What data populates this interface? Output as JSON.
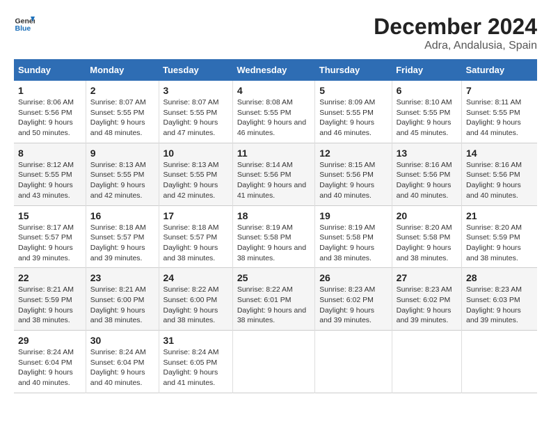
{
  "logo": {
    "general": "General",
    "blue": "Blue"
  },
  "title": "December 2024",
  "subtitle": "Adra, Andalusia, Spain",
  "headers": [
    "Sunday",
    "Monday",
    "Tuesday",
    "Wednesday",
    "Thursday",
    "Friday",
    "Saturday"
  ],
  "weeks": [
    [
      {
        "day": "1",
        "sunrise": "Sunrise: 8:06 AM",
        "sunset": "Sunset: 5:56 PM",
        "daylight": "Daylight: 9 hours and 50 minutes."
      },
      {
        "day": "2",
        "sunrise": "Sunrise: 8:07 AM",
        "sunset": "Sunset: 5:55 PM",
        "daylight": "Daylight: 9 hours and 48 minutes."
      },
      {
        "day": "3",
        "sunrise": "Sunrise: 8:07 AM",
        "sunset": "Sunset: 5:55 PM",
        "daylight": "Daylight: 9 hours and 47 minutes."
      },
      {
        "day": "4",
        "sunrise": "Sunrise: 8:08 AM",
        "sunset": "Sunset: 5:55 PM",
        "daylight": "Daylight: 9 hours and 46 minutes."
      },
      {
        "day": "5",
        "sunrise": "Sunrise: 8:09 AM",
        "sunset": "Sunset: 5:55 PM",
        "daylight": "Daylight: 9 hours and 46 minutes."
      },
      {
        "day": "6",
        "sunrise": "Sunrise: 8:10 AM",
        "sunset": "Sunset: 5:55 PM",
        "daylight": "Daylight: 9 hours and 45 minutes."
      },
      {
        "day": "7",
        "sunrise": "Sunrise: 8:11 AM",
        "sunset": "Sunset: 5:55 PM",
        "daylight": "Daylight: 9 hours and 44 minutes."
      }
    ],
    [
      {
        "day": "8",
        "sunrise": "Sunrise: 8:12 AM",
        "sunset": "Sunset: 5:55 PM",
        "daylight": "Daylight: 9 hours and 43 minutes."
      },
      {
        "day": "9",
        "sunrise": "Sunrise: 8:13 AM",
        "sunset": "Sunset: 5:55 PM",
        "daylight": "Daylight: 9 hours and 42 minutes."
      },
      {
        "day": "10",
        "sunrise": "Sunrise: 8:13 AM",
        "sunset": "Sunset: 5:55 PM",
        "daylight": "Daylight: 9 hours and 42 minutes."
      },
      {
        "day": "11",
        "sunrise": "Sunrise: 8:14 AM",
        "sunset": "Sunset: 5:56 PM",
        "daylight": "Daylight: 9 hours and 41 minutes."
      },
      {
        "day": "12",
        "sunrise": "Sunrise: 8:15 AM",
        "sunset": "Sunset: 5:56 PM",
        "daylight": "Daylight: 9 hours and 40 minutes."
      },
      {
        "day": "13",
        "sunrise": "Sunrise: 8:16 AM",
        "sunset": "Sunset: 5:56 PM",
        "daylight": "Daylight: 9 hours and 40 minutes."
      },
      {
        "day": "14",
        "sunrise": "Sunrise: 8:16 AM",
        "sunset": "Sunset: 5:56 PM",
        "daylight": "Daylight: 9 hours and 40 minutes."
      }
    ],
    [
      {
        "day": "15",
        "sunrise": "Sunrise: 8:17 AM",
        "sunset": "Sunset: 5:57 PM",
        "daylight": "Daylight: 9 hours and 39 minutes."
      },
      {
        "day": "16",
        "sunrise": "Sunrise: 8:18 AM",
        "sunset": "Sunset: 5:57 PM",
        "daylight": "Daylight: 9 hours and 39 minutes."
      },
      {
        "day": "17",
        "sunrise": "Sunrise: 8:18 AM",
        "sunset": "Sunset: 5:57 PM",
        "daylight": "Daylight: 9 hours and 38 minutes."
      },
      {
        "day": "18",
        "sunrise": "Sunrise: 8:19 AM",
        "sunset": "Sunset: 5:58 PM",
        "daylight": "Daylight: 9 hours and 38 minutes."
      },
      {
        "day": "19",
        "sunrise": "Sunrise: 8:19 AM",
        "sunset": "Sunset: 5:58 PM",
        "daylight": "Daylight: 9 hours and 38 minutes."
      },
      {
        "day": "20",
        "sunrise": "Sunrise: 8:20 AM",
        "sunset": "Sunset: 5:58 PM",
        "daylight": "Daylight: 9 hours and 38 minutes."
      },
      {
        "day": "21",
        "sunrise": "Sunrise: 8:20 AM",
        "sunset": "Sunset: 5:59 PM",
        "daylight": "Daylight: 9 hours and 38 minutes."
      }
    ],
    [
      {
        "day": "22",
        "sunrise": "Sunrise: 8:21 AM",
        "sunset": "Sunset: 5:59 PM",
        "daylight": "Daylight: 9 hours and 38 minutes."
      },
      {
        "day": "23",
        "sunrise": "Sunrise: 8:21 AM",
        "sunset": "Sunset: 6:00 PM",
        "daylight": "Daylight: 9 hours and 38 minutes."
      },
      {
        "day": "24",
        "sunrise": "Sunrise: 8:22 AM",
        "sunset": "Sunset: 6:00 PM",
        "daylight": "Daylight: 9 hours and 38 minutes."
      },
      {
        "day": "25",
        "sunrise": "Sunrise: 8:22 AM",
        "sunset": "Sunset: 6:01 PM",
        "daylight": "Daylight: 9 hours and 38 minutes."
      },
      {
        "day": "26",
        "sunrise": "Sunrise: 8:23 AM",
        "sunset": "Sunset: 6:02 PM",
        "daylight": "Daylight: 9 hours and 39 minutes."
      },
      {
        "day": "27",
        "sunrise": "Sunrise: 8:23 AM",
        "sunset": "Sunset: 6:02 PM",
        "daylight": "Daylight: 9 hours and 39 minutes."
      },
      {
        "day": "28",
        "sunrise": "Sunrise: 8:23 AM",
        "sunset": "Sunset: 6:03 PM",
        "daylight": "Daylight: 9 hours and 39 minutes."
      }
    ],
    [
      {
        "day": "29",
        "sunrise": "Sunrise: 8:24 AM",
        "sunset": "Sunset: 6:04 PM",
        "daylight": "Daylight: 9 hours and 40 minutes."
      },
      {
        "day": "30",
        "sunrise": "Sunrise: 8:24 AM",
        "sunset": "Sunset: 6:04 PM",
        "daylight": "Daylight: 9 hours and 40 minutes."
      },
      {
        "day": "31",
        "sunrise": "Sunrise: 8:24 AM",
        "sunset": "Sunset: 6:05 PM",
        "daylight": "Daylight: 9 hours and 41 minutes."
      },
      null,
      null,
      null,
      null
    ]
  ]
}
